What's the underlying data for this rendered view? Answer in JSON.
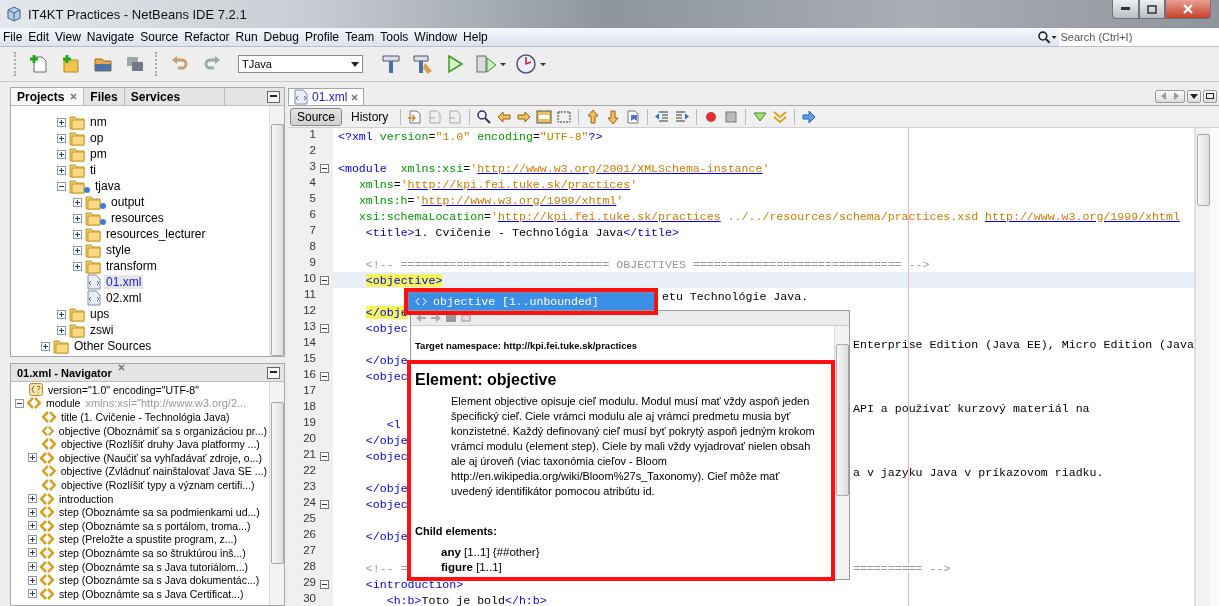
{
  "window": {
    "title": "IT4KT Practices - NetBeans IDE 7.2.1"
  },
  "menu": [
    "File",
    "Edit",
    "View",
    "Navigate",
    "Source",
    "Refactor",
    "Run",
    "Debug",
    "Profile",
    "Team",
    "Tools",
    "Window",
    "Help"
  ],
  "search": {
    "placeholder": "Search (Ctrl+I)"
  },
  "toolbar": {
    "configuration": "TJava"
  },
  "projects": {
    "tabs": [
      {
        "label": "Projects",
        "selected": true
      },
      {
        "label": "Files",
        "selected": false
      },
      {
        "label": "Services",
        "selected": false
      }
    ],
    "folders": [
      {
        "label": "nm",
        "kind": "folder",
        "expanded": false,
        "badge": false,
        "selected": false
      },
      {
        "label": "op",
        "kind": "folder",
        "expanded": false,
        "badge": false,
        "selected": false
      },
      {
        "label": "pm",
        "kind": "folder",
        "expanded": false,
        "badge": false,
        "selected": false
      },
      {
        "label": "ti",
        "kind": "folder",
        "expanded": false,
        "badge": false,
        "selected": false
      },
      {
        "label": "tjava",
        "kind": "folder",
        "expanded": true,
        "badge": true,
        "selected": false,
        "children": [
          {
            "label": "output",
            "kind": "folder",
            "expanded": false,
            "badge": true,
            "selected": false
          },
          {
            "label": "resources",
            "kind": "folder",
            "expanded": false,
            "badge": true,
            "selected": false
          },
          {
            "label": "resources_lecturer",
            "kind": "folder",
            "expanded": false,
            "badge": false,
            "selected": false
          },
          {
            "label": "style",
            "kind": "folder",
            "expanded": false,
            "badge": false,
            "selected": false
          },
          {
            "label": "transform",
            "kind": "folder",
            "expanded": false,
            "badge": false,
            "selected": false
          },
          {
            "label": "01.xml",
            "kind": "file",
            "selected": true
          },
          {
            "label": "02.xml",
            "kind": "file",
            "selected": false
          }
        ]
      },
      {
        "label": "ups",
        "kind": "folder",
        "expanded": false,
        "badge": false,
        "selected": false
      },
      {
        "label": "zswi",
        "kind": "folder",
        "expanded": false,
        "badge": false,
        "selected": false
      }
    ],
    "other_sources": {
      "label": "Other Sources",
      "expanded": false
    }
  },
  "navigator": {
    "title": "01.xml - Navigator",
    "items": [
      {
        "kind": "pi",
        "label": "version=\"1.0\" encoding=\"UTF-8\"",
        "expandable": false
      },
      {
        "kind": "element",
        "label": "module",
        "attributes": "xmlns:xsi=\"http://www.w3.org/2...",
        "expandable": true,
        "expanded": true,
        "children": [
          {
            "kind": "element",
            "label": "title (1. Cvičenie - Technológia Java)",
            "expandable": false
          },
          {
            "kind": "element",
            "label": "objective (Oboznámiť sa s organizáciou pr...)",
            "expandable": false
          },
          {
            "kind": "element",
            "label": "objective (Rozlíšiť druhy Java platformy ...)",
            "expandable": false
          },
          {
            "kind": "element",
            "label": "objective (Naučiť sa vyhľadávať zdroje, o...)",
            "expandable": true,
            "expanded": false
          },
          {
            "kind": "element",
            "label": "objective (Zvládnuť nainštalovať Java SE ...)",
            "expandable": false
          },
          {
            "kind": "element",
            "label": "objective (Rozlíšiť typy a význam certifi...)",
            "expandable": false
          },
          {
            "kind": "element",
            "label": "introduction",
            "expandable": true,
            "expanded": false
          },
          {
            "kind": "element",
            "label": "step (Oboznámte sa sa podmienkami ud...)",
            "expandable": true,
            "expanded": false
          },
          {
            "kind": "element",
            "label": "step (Oboznámte sa s portálom, troma...)",
            "expandable": true,
            "expanded": false
          },
          {
            "kind": "element",
            "label": "step (Preložte a spustite program, z...)",
            "expandable": true,
            "expanded": false
          },
          {
            "kind": "element",
            "label": "step (Oboznámte sa so štruktúrou inš...)",
            "expandable": true,
            "expanded": false
          },
          {
            "kind": "element",
            "label": "step (Oboznámte sa s Java tutoriálom...)",
            "expandable": true,
            "expanded": false
          },
          {
            "kind": "element",
            "label": "step (Oboznámte sa s Java dokumentác...)",
            "expandable": true,
            "expanded": false
          },
          {
            "kind": "element",
            "label": "step (Oboznámte sa s Java Certificat...)",
            "expandable": true,
            "expanded": false
          }
        ]
      }
    ]
  },
  "editor": {
    "tab": "01.xml",
    "views": [
      {
        "label": "Source",
        "selected": true
      },
      {
        "label": "History",
        "selected": false
      }
    ],
    "lines": [
      {
        "number": "1",
        "kind": "plain",
        "foldable": false,
        "current": false,
        "segments": [
          {
            "kind": "tag",
            "text": "<?xml"
          },
          {
            "kind": "attr",
            "text": " version"
          },
          {
            "kind": "text",
            "text": "="
          },
          {
            "kind": "value",
            "text": "\"1.0\""
          },
          {
            "kind": "attr",
            "text": " encoding"
          },
          {
            "kind": "text",
            "text": "="
          },
          {
            "kind": "value",
            "text": "\"UTF-8\""
          },
          {
            "kind": "tag",
            "text": "?>"
          }
        ]
      },
      {
        "number": "2",
        "kind": "plain",
        "foldable": false,
        "current": false
      },
      {
        "number": "3",
        "kind": "plain",
        "foldable": true,
        "current": false,
        "segments": [
          {
            "kind": "tag",
            "text": "<module"
          },
          {
            "kind": "attr",
            "text": "  xmlns:xsi"
          },
          {
            "kind": "text",
            "text": "="
          },
          {
            "kind": "value",
            "text": "'"
          },
          {
            "kind": "link",
            "text": "http://www.w3.org/2001/XMLSchema-instance"
          },
          {
            "kind": "value",
            "text": "'"
          }
        ]
      },
      {
        "number": "4",
        "kind": "plain",
        "foldable": false,
        "current": false,
        "segments": [
          {
            "kind": "attr",
            "text": "   xmlns"
          },
          {
            "kind": "text",
            "text": "="
          },
          {
            "kind": "value",
            "text": "'"
          },
          {
            "kind": "link",
            "text": "http://kpi.fei.tuke.sk/practices"
          },
          {
            "kind": "value",
            "text": "'"
          }
        ]
      },
      {
        "number": "5",
        "kind": "plain",
        "foldable": false,
        "current": false,
        "segments": [
          {
            "kind": "attr",
            "text": "   xmlns:h"
          },
          {
            "kind": "text",
            "text": "="
          },
          {
            "kind": "value",
            "text": "'"
          },
          {
            "kind": "link",
            "text": "http://www.w3.org/1999/xhtml"
          },
          {
            "kind": "value",
            "text": "'"
          }
        ]
      },
      {
        "number": "6",
        "kind": "plain",
        "foldable": false,
        "current": false,
        "segments": [
          {
            "kind": "attr",
            "text": "   xsi:schemaLocation"
          },
          {
            "kind": "text",
            "text": "="
          },
          {
            "kind": "value",
            "text": "'"
          },
          {
            "kind": "link",
            "text": "http://kpi.fei.tuke.sk/practices"
          },
          {
            "kind": "value",
            "text": " ../../resources/schema/practices.xsd "
          },
          {
            "kind": "link",
            "text": "http://www.w3.org/1999/xhtml"
          }
        ]
      },
      {
        "number": "7",
        "kind": "plain",
        "foldable": false,
        "current": false,
        "segments": [
          {
            "kind": "tag",
            "text": "    <title>"
          },
          {
            "kind": "text",
            "text": "1. Cvičenie - Technológia Java"
          },
          {
            "kind": "tag",
            "text": "</title>"
          }
        ]
      },
      {
        "number": "8",
        "kind": "plain",
        "foldable": false,
        "current": false
      },
      {
        "number": "9",
        "kind": "plain",
        "foldable": false,
        "current": false,
        "segments": [
          {
            "kind": "comment",
            "text": "    <!-- ============================== OBJECTIVES ============================== -->"
          }
        ]
      },
      {
        "number": "10",
        "kind": "plain",
        "foldable": true,
        "current": true,
        "segments": [
          {
            "kind": "match",
            "text": "    <objective>"
          }
        ]
      },
      {
        "number": "11",
        "kind": "completion",
        "foldable": false,
        "current": false,
        "tail": {
          "kind": "text",
          "text": "etu Technológie Java."
        }
      },
      {
        "number": "12",
        "kind": "popup",
        "foldable": false,
        "current": false,
        "segments": [
          {
            "kind": "match",
            "text": "    </obje"
          }
        ]
      },
      {
        "number": "13",
        "kind": "popup",
        "foldable": true,
        "current": false,
        "segments": [
          {
            "kind": "tag",
            "text": "    <objec"
          }
        ]
      },
      {
        "number": "14",
        "kind": "popup",
        "foldable": false,
        "current": false,
        "tail": {
          "kind": "text",
          "text": "Enterprise Edition (Java EE), Micro Edition (Java"
        }
      },
      {
        "number": "15",
        "kind": "popup",
        "foldable": false,
        "current": false,
        "segments": [
          {
            "kind": "tag",
            "text": "    </obje"
          }
        ]
      },
      {
        "number": "16",
        "kind": "popup",
        "foldable": true,
        "current": false,
        "segments": [
          {
            "kind": "tag",
            "text": "    <objec"
          }
        ]
      },
      {
        "number": "17",
        "kind": "popup",
        "foldable": false,
        "current": false
      },
      {
        "number": "18",
        "kind": "popup",
        "foldable": false,
        "current": false,
        "tail": {
          "kind": "text",
          "text": "API a používať kurzový materiál na"
        }
      },
      {
        "number": "19",
        "kind": "popup",
        "foldable": false,
        "current": false,
        "segments": [
          {
            "kind": "tag",
            "text": "       <l"
          }
        ]
      },
      {
        "number": "20",
        "kind": "popup",
        "foldable": false,
        "current": false,
        "segments": [
          {
            "kind": "tag",
            "text": "    </obje"
          }
        ]
      },
      {
        "number": "21",
        "kind": "popup",
        "foldable": true,
        "current": false,
        "segments": [
          {
            "kind": "tag",
            "text": "    <objec"
          }
        ]
      },
      {
        "number": "22",
        "kind": "popup",
        "foldable": false,
        "current": false,
        "tail": {
          "kind": "text",
          "text": "a v jazyku Java v príkazovom riadku."
        }
      },
      {
        "number": "23",
        "kind": "popup",
        "foldable": false,
        "current": false,
        "segments": [
          {
            "kind": "tag",
            "text": "    </obje"
          }
        ]
      },
      {
        "number": "24",
        "kind": "popup",
        "foldable": true,
        "current": false,
        "segments": [
          {
            "kind": "tag",
            "text": "    <objec"
          }
        ]
      },
      {
        "number": "25",
        "kind": "popup",
        "foldable": false,
        "current": false
      },
      {
        "number": "26",
        "kind": "popup",
        "foldable": false,
        "current": false,
        "segments": [
          {
            "kind": "tag",
            "text": "    </obje"
          }
        ]
      },
      {
        "number": "27",
        "kind": "popup",
        "foldable": false,
        "current": false
      },
      {
        "number": "28",
        "kind": "popup",
        "foldable": false,
        "current": false,
        "segments": [
          {
            "kind": "comment",
            "text": "    <!-- ="
          }
        ],
        "tail": {
          "kind": "comment",
          "text": "========== -->"
        }
      },
      {
        "number": "29",
        "kind": "plain",
        "foldable": true,
        "current": false,
        "segments": [
          {
            "kind": "tag",
            "text": "    <introduction>"
          }
        ]
      },
      {
        "number": "30",
        "kind": "plain",
        "foldable": false,
        "current": false,
        "segments": [
          {
            "kind": "tag",
            "text": "       <h:b>"
          },
          {
            "kind": "text",
            "text": "Toto je bold"
          },
          {
            "kind": "tag",
            "text": "</h:b>"
          }
        ]
      }
    ]
  },
  "completion": {
    "items": [
      {
        "label": "objective [1..unbounded]",
        "selected": true
      }
    ]
  },
  "documentation": {
    "namespace": "Target namespace: http://kpi.fei.tuke.sk/practices",
    "heading": "Element: objective",
    "description": "Element objective opisuje cieľ modulu. Modul musí mať vždy aspoň jeden špecifický cieľ. Ciele vrámci modulu ale aj vrámci predmetu musia byť konzistetné. Každý definovaný cieľ musí byť pokrytý aspoň jedným krokom vrámci modulu (element step). Ciele by mali vždy vyjadrovať nielen obsah ale aj úroveň (viac taxonómia cieľov - Bloom http://en.wikipedia.org/wiki/Bloom%27s_Taxonomy). Cieľ môže mať uvedený identifikátor pomocou atribútu id.",
    "child_heading": "Child elements:",
    "children": [
      "**any** [1..1] {##other}",
      "**figure** [1..1]"
    ]
  }
}
